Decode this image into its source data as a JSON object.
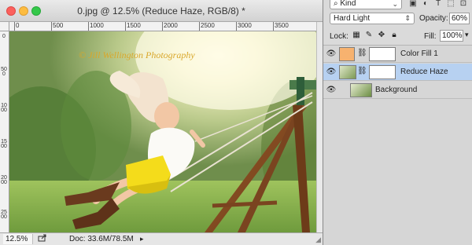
{
  "document": {
    "title": "0.jpg @ 12.5% (Reduce Haze, RGB/8) *",
    "ruler_h": [
      "0",
      "500",
      "1000",
      "1500",
      "2000",
      "2500",
      "3000",
      "3500"
    ],
    "ruler_v": [
      "0",
      "500",
      "1000",
      "1500",
      "2000",
      "2500"
    ],
    "watermark": "© Jill Wellington Photography",
    "status": {
      "zoom": "12.5%",
      "share_icon": "export-icon",
      "doc_size": "Doc: 33.6M/78.5M",
      "arrow": "▸"
    }
  },
  "layers_panel": {
    "filter_kind": "Kind",
    "filter_icons": [
      "image-filter-icon",
      "adjustment-filter-icon",
      "type-filter-icon",
      "shape-filter-icon",
      "smart-object-filter-icon"
    ],
    "blend_mode": "Hard Light",
    "opacity_label": "Opacity:",
    "opacity_value": "60%",
    "lock_label": "Lock:",
    "lock_icons": [
      "lock-transparent-icon",
      "lock-image-icon",
      "lock-position-icon",
      "lock-all-icon"
    ],
    "fill_label": "Fill:",
    "fill_value": "100%",
    "layers": [
      {
        "name": "Color Fill 1",
        "visible": true,
        "selected": false,
        "thumb_color": "#f7b26f"
      },
      {
        "name": "Reduce Haze",
        "visible": true,
        "selected": true
      },
      {
        "name": "Background",
        "visible": true,
        "selected": false
      }
    ]
  }
}
